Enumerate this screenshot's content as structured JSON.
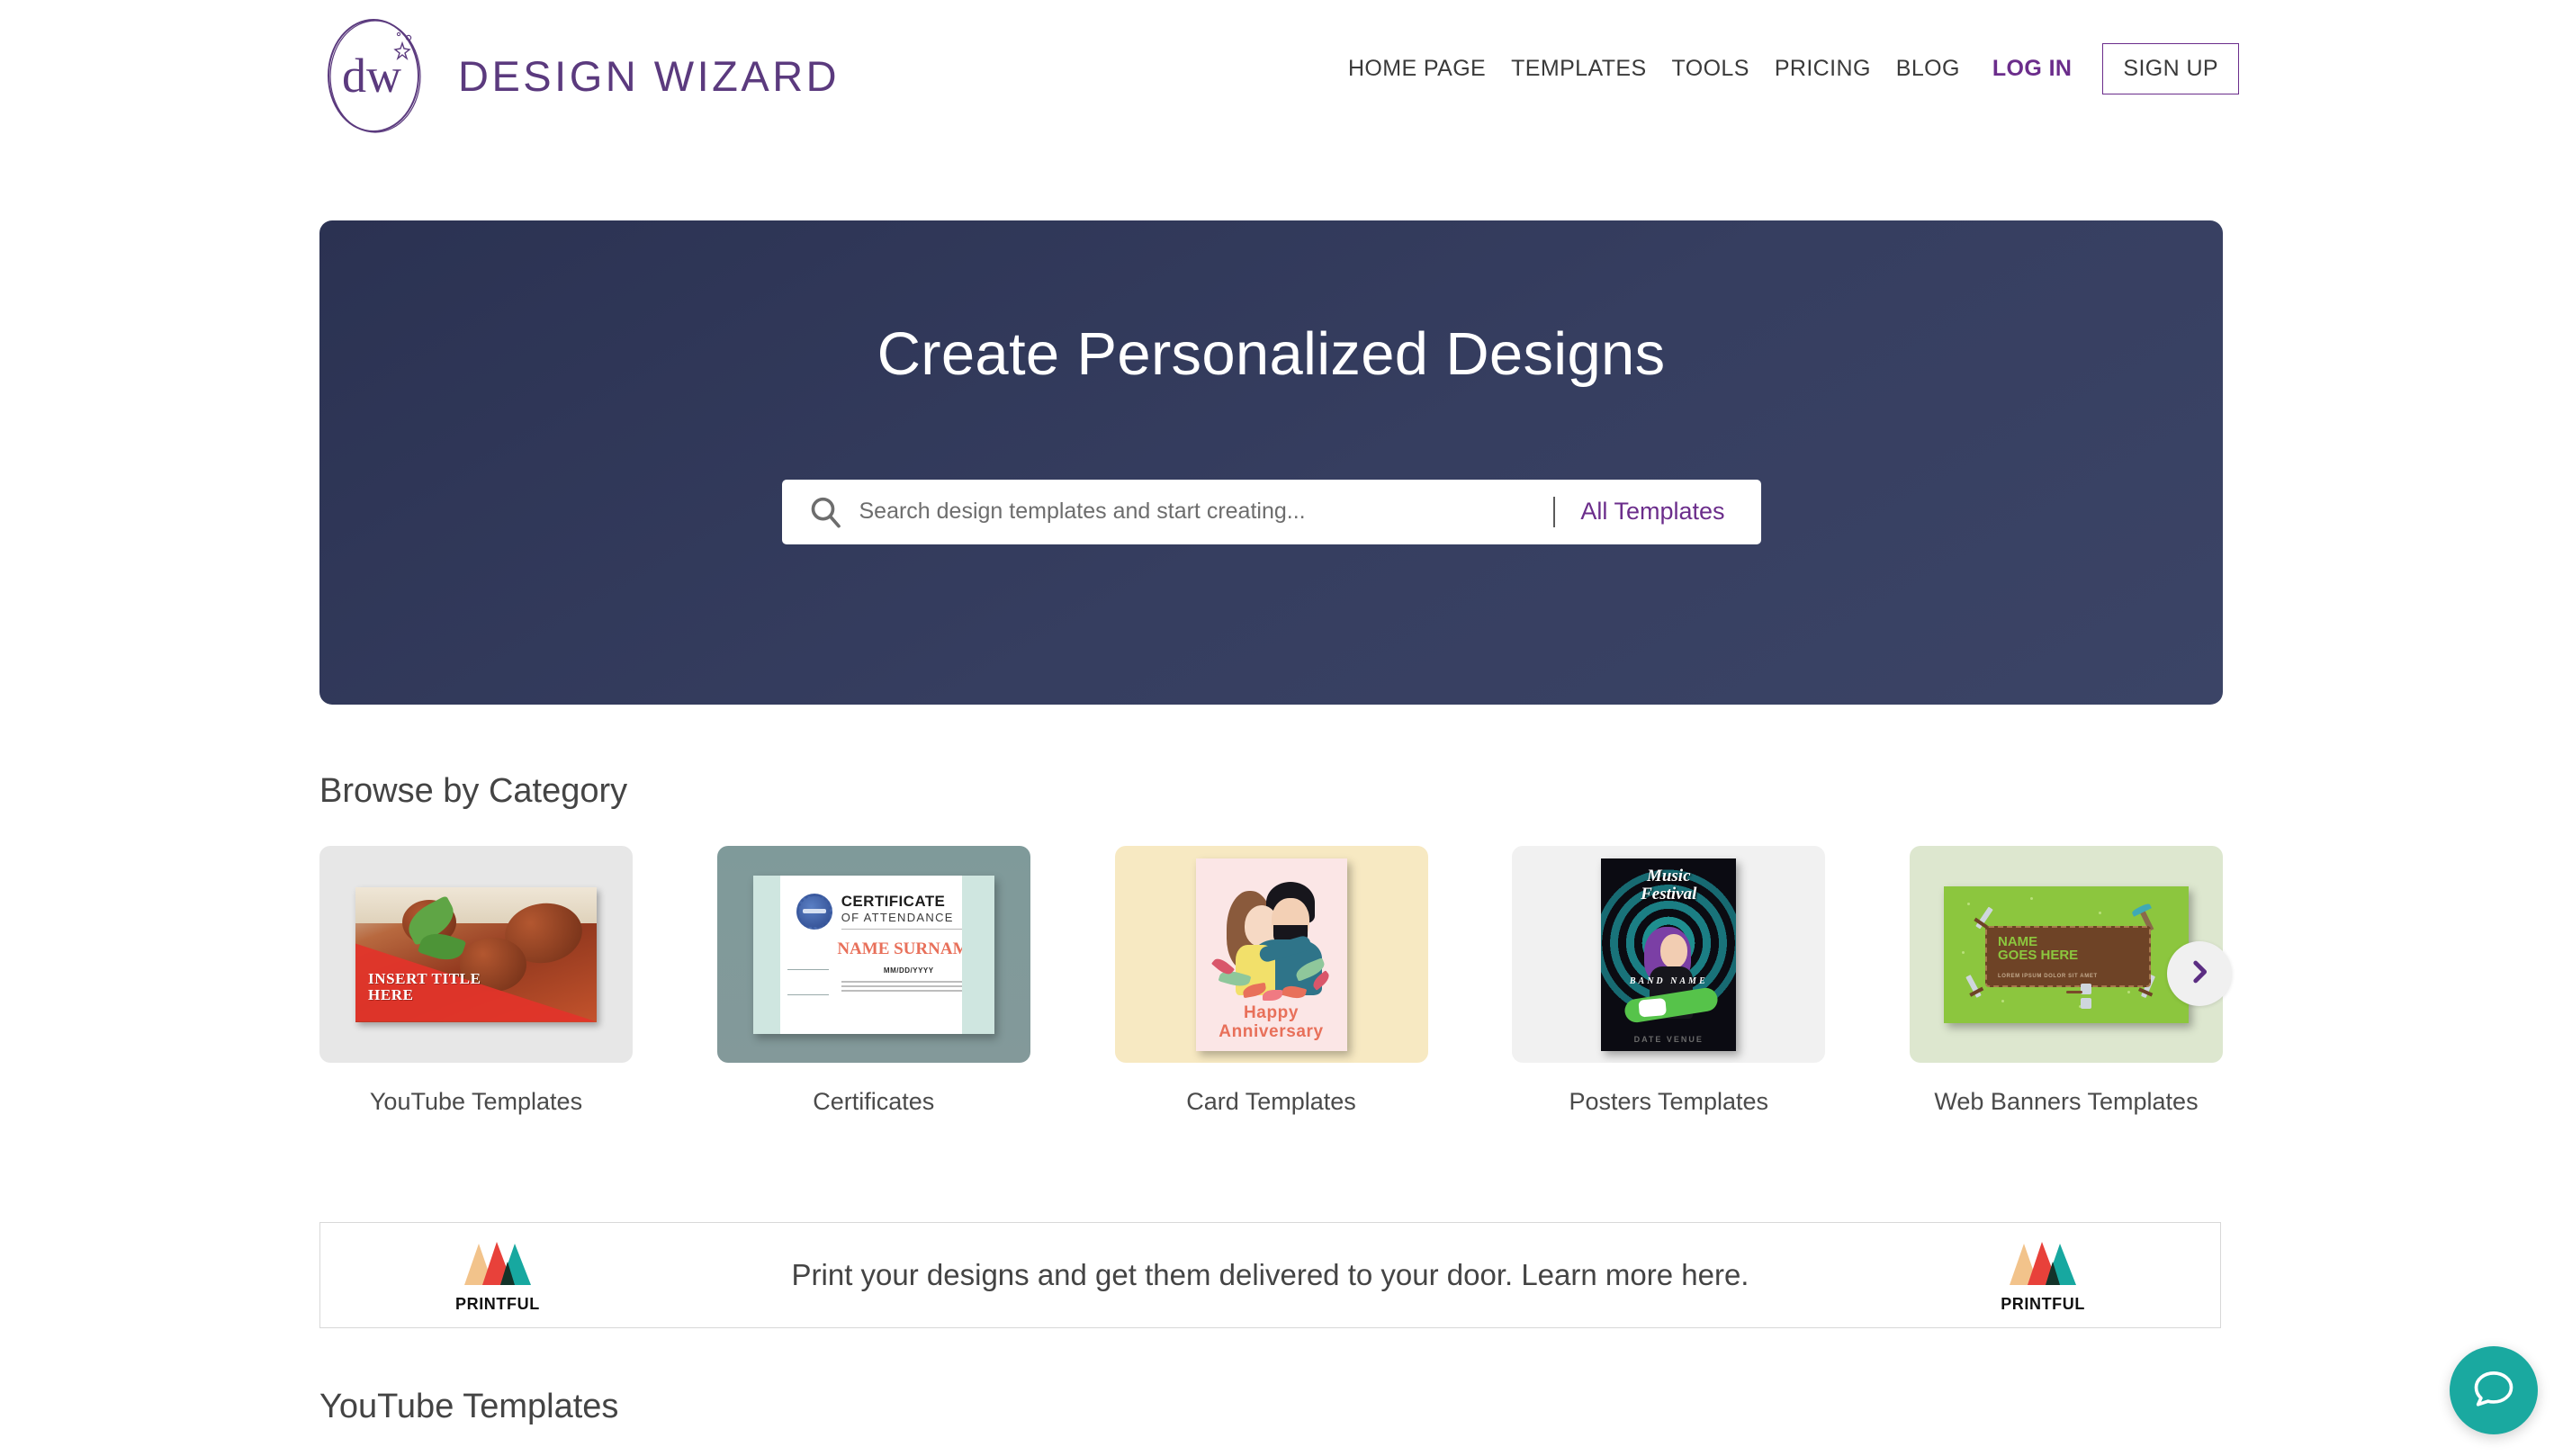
{
  "browser": {
    "tab_chevron_icon": "chevron-down-icon"
  },
  "header": {
    "logo": {
      "monogram": "dw",
      "wordmark": "DESIGN WIZARD"
    },
    "nav": [
      {
        "label": "HOME PAGE",
        "style": "plain"
      },
      {
        "label": "TEMPLATES",
        "style": "plain"
      },
      {
        "label": "TOOLS",
        "style": "plain"
      },
      {
        "label": "PRICING",
        "style": "plain"
      },
      {
        "label": "BLOG",
        "style": "plain"
      },
      {
        "label": "LOG IN",
        "style": "accent"
      },
      {
        "label": "SIGN UP",
        "style": "outlined"
      }
    ]
  },
  "hero": {
    "title": "Create Personalized Designs",
    "search": {
      "placeholder": "Search design templates and start creating...",
      "value": "",
      "icon": "search-icon",
      "filter_label": "All Templates"
    },
    "bg_color": "#2b3252"
  },
  "browse": {
    "heading": "Browse by Category",
    "next_arrow_icon": "chevron-right-icon",
    "categories": [
      {
        "label": "YouTube Templates",
        "card_bg": "#e7e7e7",
        "thumb_text_line1": "INSERT TITLE",
        "thumb_text_line2": "HERE"
      },
      {
        "label": "Certificates",
        "card_bg": "#7f9a9a",
        "cert_title": "CERTIFICATE",
        "cert_subtitle": "OF ATTENDANCE",
        "cert_name": "NAME SURNAME",
        "cert_date": "MM/DD/YYYY"
      },
      {
        "label": "Card Templates",
        "card_bg": "#f7e9c2",
        "card_line1": "Happy",
        "card_line2": "Anniversary"
      },
      {
        "label": "Posters Templates",
        "card_bg": "#f1f1f1",
        "poster_title_line1": "Music",
        "poster_title_line2": "Festival",
        "poster_band": "BAND NAME",
        "poster_footer": "DATE  VENUE"
      },
      {
        "label": "Web Banners Templates",
        "card_bg": "#dde7cf",
        "banner_line1": "NAME",
        "banner_line2": "GOES HERE",
        "banner_sub": "LOREM IPSUM DOLOR SIT AMET"
      }
    ]
  },
  "printful": {
    "message": "Print your designs and get them delivered to your door. Learn more here.",
    "brand": "PRINTFUL",
    "logo_colors": [
      "#f2c38b",
      "#e8413a",
      "#17a8a0",
      "#133329"
    ]
  },
  "youtube_section": {
    "heading": "YouTube Templates"
  },
  "chat": {
    "icon": "chat-bubble-icon",
    "color": "#1aa9a0"
  },
  "theme": {
    "accent_purple": "#6b2d8b",
    "logo_purple": "#5b3a7e",
    "text_dark": "#3a3a3a"
  }
}
